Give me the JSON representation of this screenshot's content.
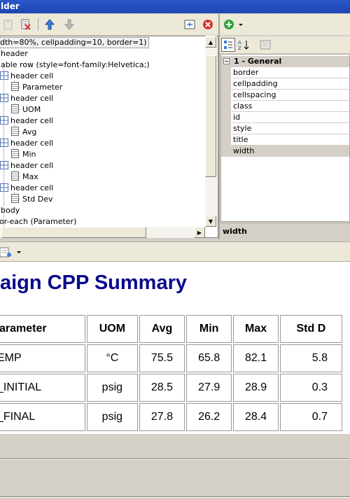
{
  "window": {
    "title": "lder"
  },
  "tree": {
    "selected_row": "dth=80%, cellpadding=10, border=1)",
    "rows": [
      "header",
      "able row (style=font-family:Helvetica;)",
      "header cell",
      "Parameter",
      "header cell",
      "UOM",
      "header cell",
      "Avg",
      "header cell",
      "Min",
      "header cell",
      "Max",
      "header cell",
      "Std Dev",
      "body",
      "or-each (Parameter)"
    ]
  },
  "properties": {
    "category": "1 - General",
    "items": [
      "border",
      "cellpadding",
      "cellspacing",
      "class",
      "id",
      "style",
      "title",
      "width"
    ],
    "selected": "width",
    "description": "width"
  },
  "preview": {
    "title": "aign CPP Summary",
    "headers": [
      "arameter",
      "UOM",
      "Avg",
      "Min",
      "Max",
      "Std D"
    ],
    "rows": [
      [
        "EMP",
        "°C",
        "75.5",
        "65.8",
        "82.1",
        "5.8"
      ],
      [
        "_INITIAL",
        "psig",
        "28.5",
        "27.9",
        "28.9",
        "0.3"
      ],
      [
        "_FINAL",
        "psig",
        "27.8",
        "26.2",
        "28.4",
        "0.7"
      ]
    ]
  },
  "colors": {
    "title_bar": "#1e46b2",
    "report_title": "#0a0a8c",
    "delete_icon": "#d9342b",
    "add_icon": "#2fa33a"
  }
}
